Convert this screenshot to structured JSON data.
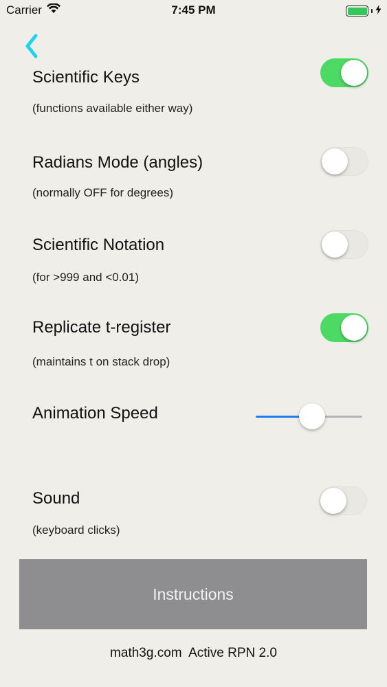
{
  "status_bar": {
    "carrier": "Carrier",
    "time": "7:45 PM",
    "battery_color": "#34c759"
  },
  "nav": {
    "back_icon": "chevron-left-icon",
    "accent_color": "#1fd3f0"
  },
  "settings": [
    {
      "title": "Scientific Keys",
      "subtitle": "(functions available either way)",
      "on": true
    },
    {
      "title": "Radians Mode (angles)",
      "subtitle": "(normally OFF for degrees)",
      "on": false
    },
    {
      "title": "Scientific Notation",
      "subtitle": "(for >999 and <0.01)",
      "on": false
    },
    {
      "title": "Replicate t-register",
      "subtitle": "(maintains t on stack drop)",
      "on": true
    }
  ],
  "animation_speed": {
    "title": "Animation Speed",
    "value_fraction": 0.53
  },
  "sound": {
    "title": "Sound",
    "subtitle": "(keyboard clicks)",
    "on": false
  },
  "instructions_button": {
    "label": "Instructions"
  },
  "footer": {
    "text": "math3g.com  Active RPN 2.0"
  },
  "colors": {
    "toggle_on": "#4cd964",
    "slider_min_track": "#1a7cf0",
    "background": "#efeee8"
  }
}
